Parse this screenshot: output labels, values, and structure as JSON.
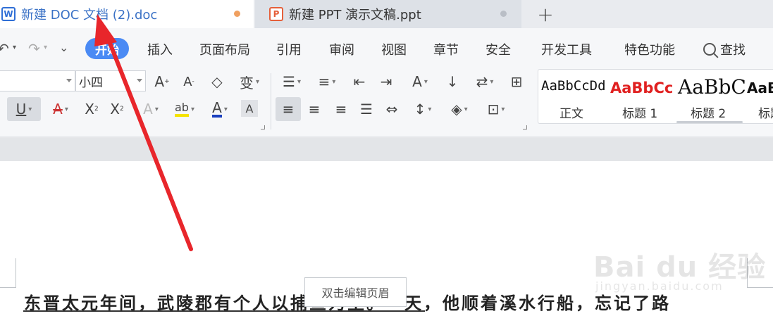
{
  "tabs": [
    {
      "icon": "W",
      "title": "新建 DOC 文档 (2).doc"
    },
    {
      "icon": "P",
      "title": "新建 PPT 演示文稿.ppt"
    }
  ],
  "tab_add_label": "+",
  "menu": {
    "active": "开始",
    "items": [
      "插入",
      "页面布局",
      "引用",
      "审阅",
      "视图",
      "章节",
      "安全",
      "开发工具",
      "特色功能"
    ],
    "search_label": "查找"
  },
  "ribbon": {
    "font_size": "小四",
    "styles": [
      {
        "sample": "AaBbCcDd",
        "name": "正文"
      },
      {
        "sample": "AaBbCc",
        "name": "标题 1"
      },
      {
        "sample": "AaBbC",
        "name": "标题 2"
      },
      {
        "sample": "AaB",
        "name": "标题"
      }
    ]
  },
  "document": {
    "header_hint": "双击编辑页眉",
    "body_text": "东晋太元年间，武陵郡有个人以捕鱼为生。一天，他顺着溪水行船，忘记了路",
    "watermark": "Bai du 经验",
    "watermark_sub": "jingyan.baidu.com"
  },
  "colors": {
    "accent": "#4a8af4",
    "heading1": "#e02020",
    "arrow": "#e8262b"
  }
}
